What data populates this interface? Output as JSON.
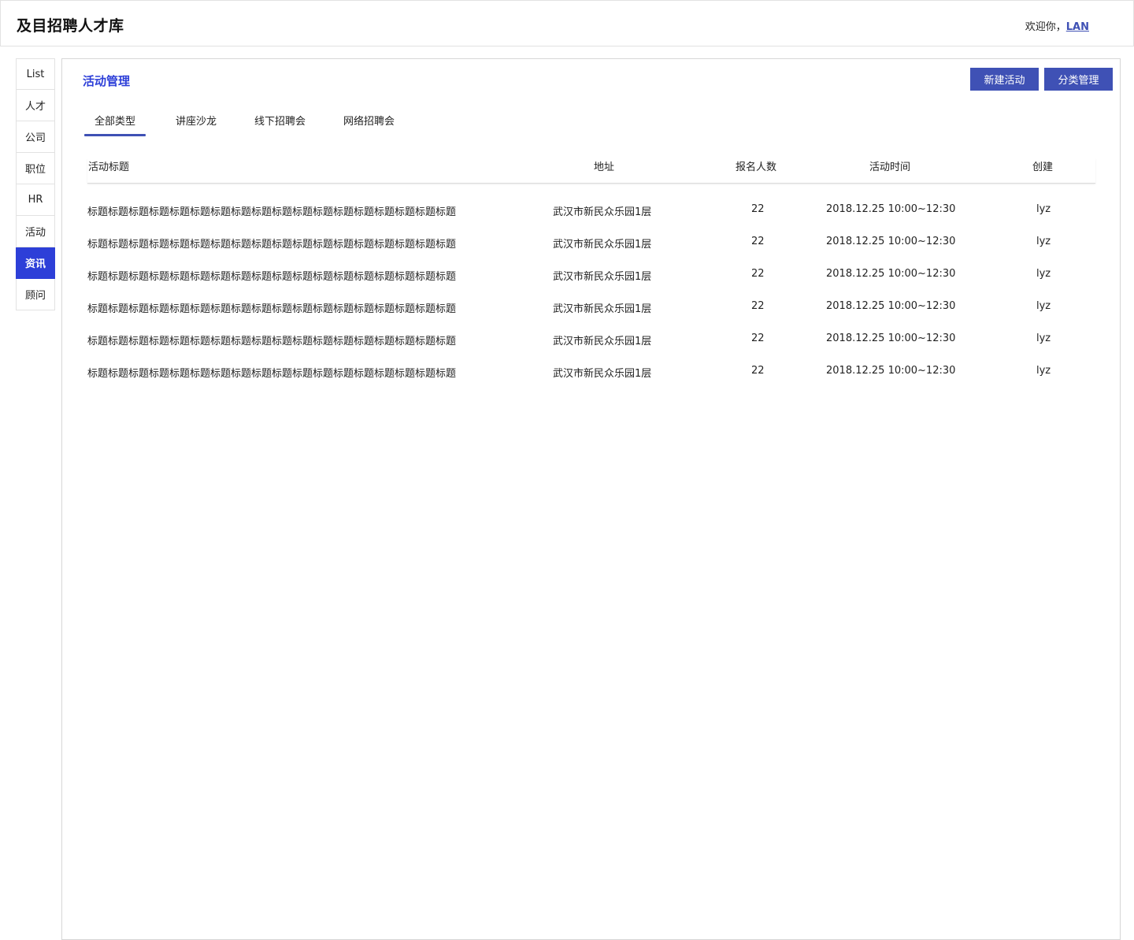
{
  "header": {
    "app_title": "及目招聘人才库",
    "welcome_prefix": "欢迎你，",
    "user_name": "LAN"
  },
  "sidebar": {
    "items": [
      {
        "label": "List"
      },
      {
        "label": "人才"
      },
      {
        "label": "公司"
      },
      {
        "label": "职位"
      },
      {
        "label": "HR"
      },
      {
        "label": "活动"
      },
      {
        "label": "资讯",
        "active": true
      },
      {
        "label": "顾问"
      }
    ]
  },
  "main": {
    "title": "活动管理",
    "buttons": {
      "new_activity": "新建活动",
      "category_manage": "分类管理"
    },
    "tabs": [
      {
        "label": "全部类型",
        "active": true
      },
      {
        "label": "讲座沙龙"
      },
      {
        "label": "线下招聘会"
      },
      {
        "label": "网络招聘会"
      }
    ],
    "table": {
      "headers": [
        "活动标题",
        "地址",
        "报名人数",
        "活动时间",
        "创建"
      ],
      "rows": [
        [
          "标题标题标题标题标题标题标题标题标题标题标题标题标题标题标题标题标题标题",
          "武汉市新民众乐园1层",
          "22",
          "2018.12.25 10:00~12:30",
          "lyz"
        ],
        [
          "标题标题标题标题标题标题标题标题标题标题标题标题标题标题标题标题标题标题",
          "武汉市新民众乐园1层",
          "22",
          "2018.12.25 10:00~12:30",
          "lyz"
        ],
        [
          "标题标题标题标题标题标题标题标题标题标题标题标题标题标题标题标题标题标题",
          "武汉市新民众乐园1层",
          "22",
          "2018.12.25 10:00~12:30",
          "lyz"
        ],
        [
          "标题标题标题标题标题标题标题标题标题标题标题标题标题标题标题标题标题标题",
          "武汉市新民众乐园1层",
          "22",
          "2018.12.25 10:00~12:30",
          "lyz"
        ],
        [
          "标题标题标题标题标题标题标题标题标题标题标题标题标题标题标题标题标题标题",
          "武汉市新民众乐园1层",
          "22",
          "2018.12.25 10:00~12:30",
          "lyz"
        ],
        [
          "标题标题标题标题标题标题标题标题标题标题标题标题标题标题标题标题标题标题",
          "武汉市新民众乐园1层",
          "22",
          "2018.12.25 10:00~12:30",
          "lyz"
        ]
      ]
    }
  },
  "colors": {
    "accent": "#3f51b5",
    "active_nav": "#2d3fd8",
    "border": "#e2e2e2"
  }
}
